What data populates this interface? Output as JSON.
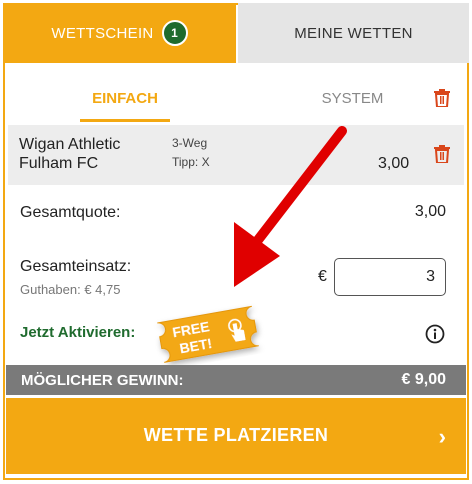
{
  "tabs": {
    "betslip_label": "WETTSCHEIN",
    "betslip_count": "1",
    "my_bets_label": "MEINE WETTEN"
  },
  "subtabs": {
    "single_label": "EINFACH",
    "system_label": "SYSTEM"
  },
  "selection": {
    "home_team": "Wigan Athletic",
    "away_team": "Fulham FC",
    "market": "3-Weg",
    "tip": "Tipp: X",
    "odds": "3,00"
  },
  "summary": {
    "total_odds_label": "Gesamtquote:",
    "total_odds_value": "3,00",
    "total_stake_label": "Gesamteinsatz:",
    "balance_text": "Guthaben: € 4,75",
    "currency_symbol": "€",
    "stake_value": "3"
  },
  "freebet": {
    "activate_label": "Jetzt Aktivieren:",
    "ticket_line1": "FREE",
    "ticket_line2": "BET!"
  },
  "potential_win": {
    "label": "MÖGLICHER GEWINN:",
    "value": "€ 9,00"
  },
  "place_button": {
    "label": "WETTE PLATZIEREN",
    "chevron": "›"
  },
  "icons": {
    "trash": "trash-icon",
    "info": "info-icon",
    "arrow": "red-arrow-annotation",
    "hand": "hand-pointer-icon"
  },
  "colors": {
    "accent": "#f3a812",
    "badge_green": "#1f6b2e",
    "trash_red": "#d9461b",
    "arrow_red": "#e00000",
    "win_bar": "#7a7a7a"
  }
}
